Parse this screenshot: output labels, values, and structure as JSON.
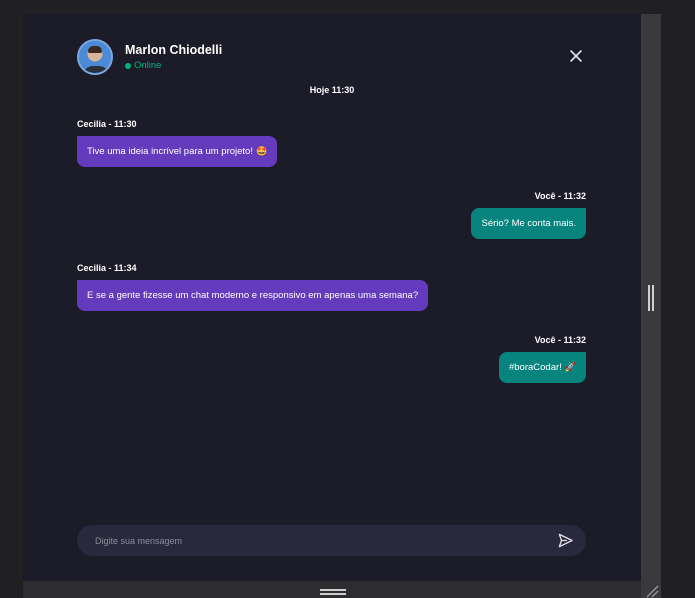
{
  "contact": {
    "name": "Marlon Chiodelli",
    "status": "Online"
  },
  "chat": {
    "day_label": "Hoje 11:30",
    "messages": [
      {
        "sender": "Cecilia",
        "meta": "Cecilia - 11:30",
        "text": "Tive uma ideia incrível para um projeto!",
        "emoji": "🤩",
        "direction": "received"
      },
      {
        "sender": "Você",
        "meta": "Você - 11:32",
        "text": "Sério? Me conta mais.",
        "direction": "sent"
      },
      {
        "sender": "Cecilia",
        "meta": "Cecilia - 11:34",
        "text": "E se a gente fizesse um chat moderno e responsivo em apenas uma semana?",
        "direction": "received"
      },
      {
        "sender": "Você",
        "meta": "Você - 11:32",
        "text": "#boraCodar!",
        "emoji": "🚀",
        "direction": "sent"
      }
    ]
  },
  "composer": {
    "placeholder": "Digite sua mensagem"
  },
  "colors": {
    "background": "#1c1b28",
    "received_bubble": "#633bbc",
    "sent_bubble": "#07847e",
    "online": "#00b37e",
    "input": "#29283d"
  },
  "icons": {
    "close": "close-icon",
    "send": "send-icon",
    "status": "online-dot-icon"
  }
}
